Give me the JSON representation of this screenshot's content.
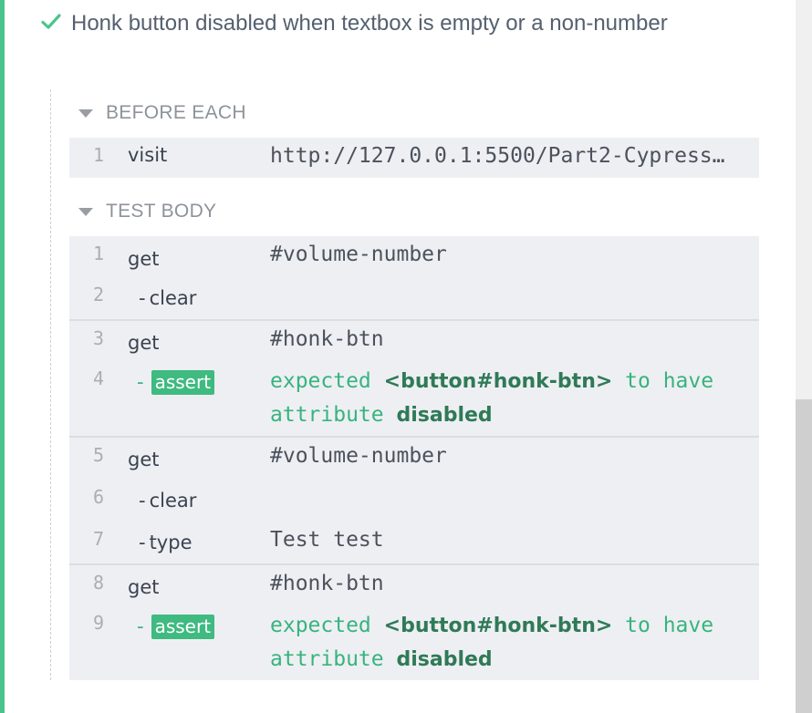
{
  "test": {
    "title": "Honk button disabled when textbox is empty or a non-number",
    "status_icon": "check-icon",
    "status_color": "#4ac48a"
  },
  "before_each": {
    "header": "BEFORE EACH",
    "commands": [
      {
        "num": "1",
        "name": "visit",
        "message": "http://127.0.0.1:5500/Part2-Cypress…"
      }
    ]
  },
  "test_body": {
    "header": "TEST BODY",
    "commands": [
      {
        "num": "1",
        "name": "get",
        "message": "#volume-number"
      },
      {
        "num": "2",
        "name": "clear",
        "message": ""
      },
      {
        "num": "3",
        "name": "get",
        "message": "#honk-btn"
      },
      {
        "num": "4",
        "name": "assert",
        "message_pre": "expected",
        "message_elem": "<button#honk-btn>",
        "message_mid": "to have",
        "message_line2_pre": "attribute",
        "message_line2_val": "disabled"
      },
      {
        "num": "5",
        "name": "get",
        "message": "#volume-number"
      },
      {
        "num": "6",
        "name": "clear",
        "message": ""
      },
      {
        "num": "7",
        "name": "type",
        "message": "Test test"
      },
      {
        "num": "8",
        "name": "get",
        "message": "#honk-btn"
      },
      {
        "num": "9",
        "name": "assert",
        "message_pre": "expected",
        "message_elem": "<button#honk-btn>",
        "message_mid": "to have",
        "message_line2_pre": "attribute",
        "message_line2_val": "disabled"
      }
    ]
  },
  "colors": {
    "pass": "#4ac48a",
    "assert_badge": "#3fba80",
    "command_bg": "#eeeff3"
  }
}
